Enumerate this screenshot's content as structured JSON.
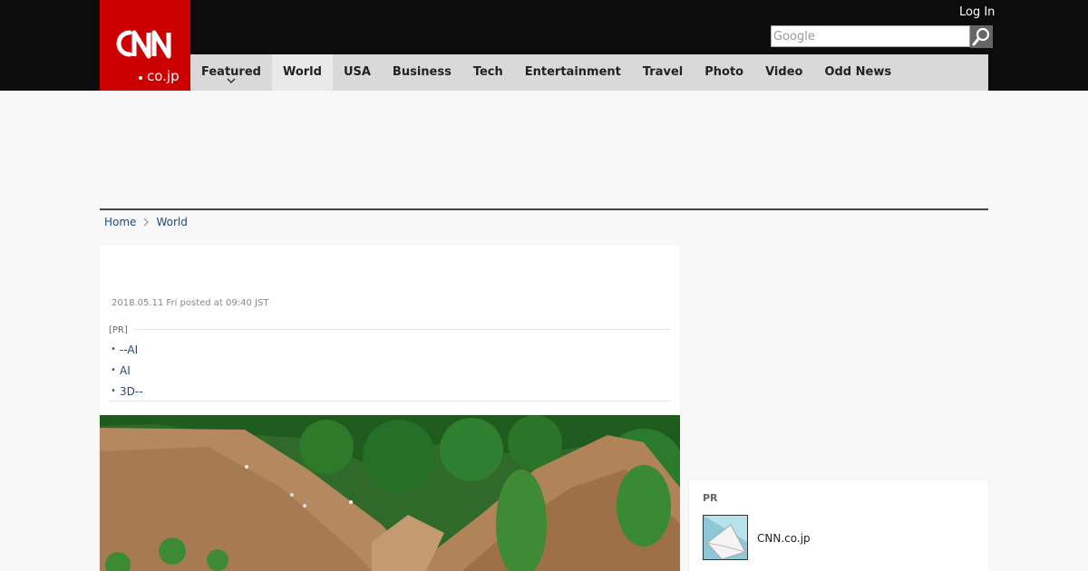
{
  "header": {
    "logo_alt": "CNN.co.jp",
    "login_label": "Log In",
    "search_placeholder": "Google"
  },
  "nav": {
    "items": [
      {
        "label": "Featured"
      },
      {
        "label": "World"
      },
      {
        "label": "USA"
      },
      {
        "label": "Business"
      },
      {
        "label": "Tech"
      },
      {
        "label": "Entertainment"
      },
      {
        "label": "Travel"
      },
      {
        "label": "Photo"
      },
      {
        "label": "Video"
      },
      {
        "label": "Odd News"
      }
    ],
    "active": "World"
  },
  "breadcrumb": {
    "home": "Home",
    "current": "World"
  },
  "article": {
    "posted": "2018.05.11 Fri posted at 09:40 JST",
    "pr_label": "[PR]",
    "pr_links": [
      {
        "label": "--AI"
      },
      {
        "label": "AI"
      },
      {
        "label": "3D--"
      }
    ]
  },
  "sidebar": {
    "pr_label": "PR",
    "pr_item_text": "CNN.co.jp"
  },
  "colors": {
    "brand_red": "#cc0000",
    "header_black": "#0c0c0c",
    "nav_gray": "#d9d9d9",
    "link_blue": "#1e4a7a"
  }
}
